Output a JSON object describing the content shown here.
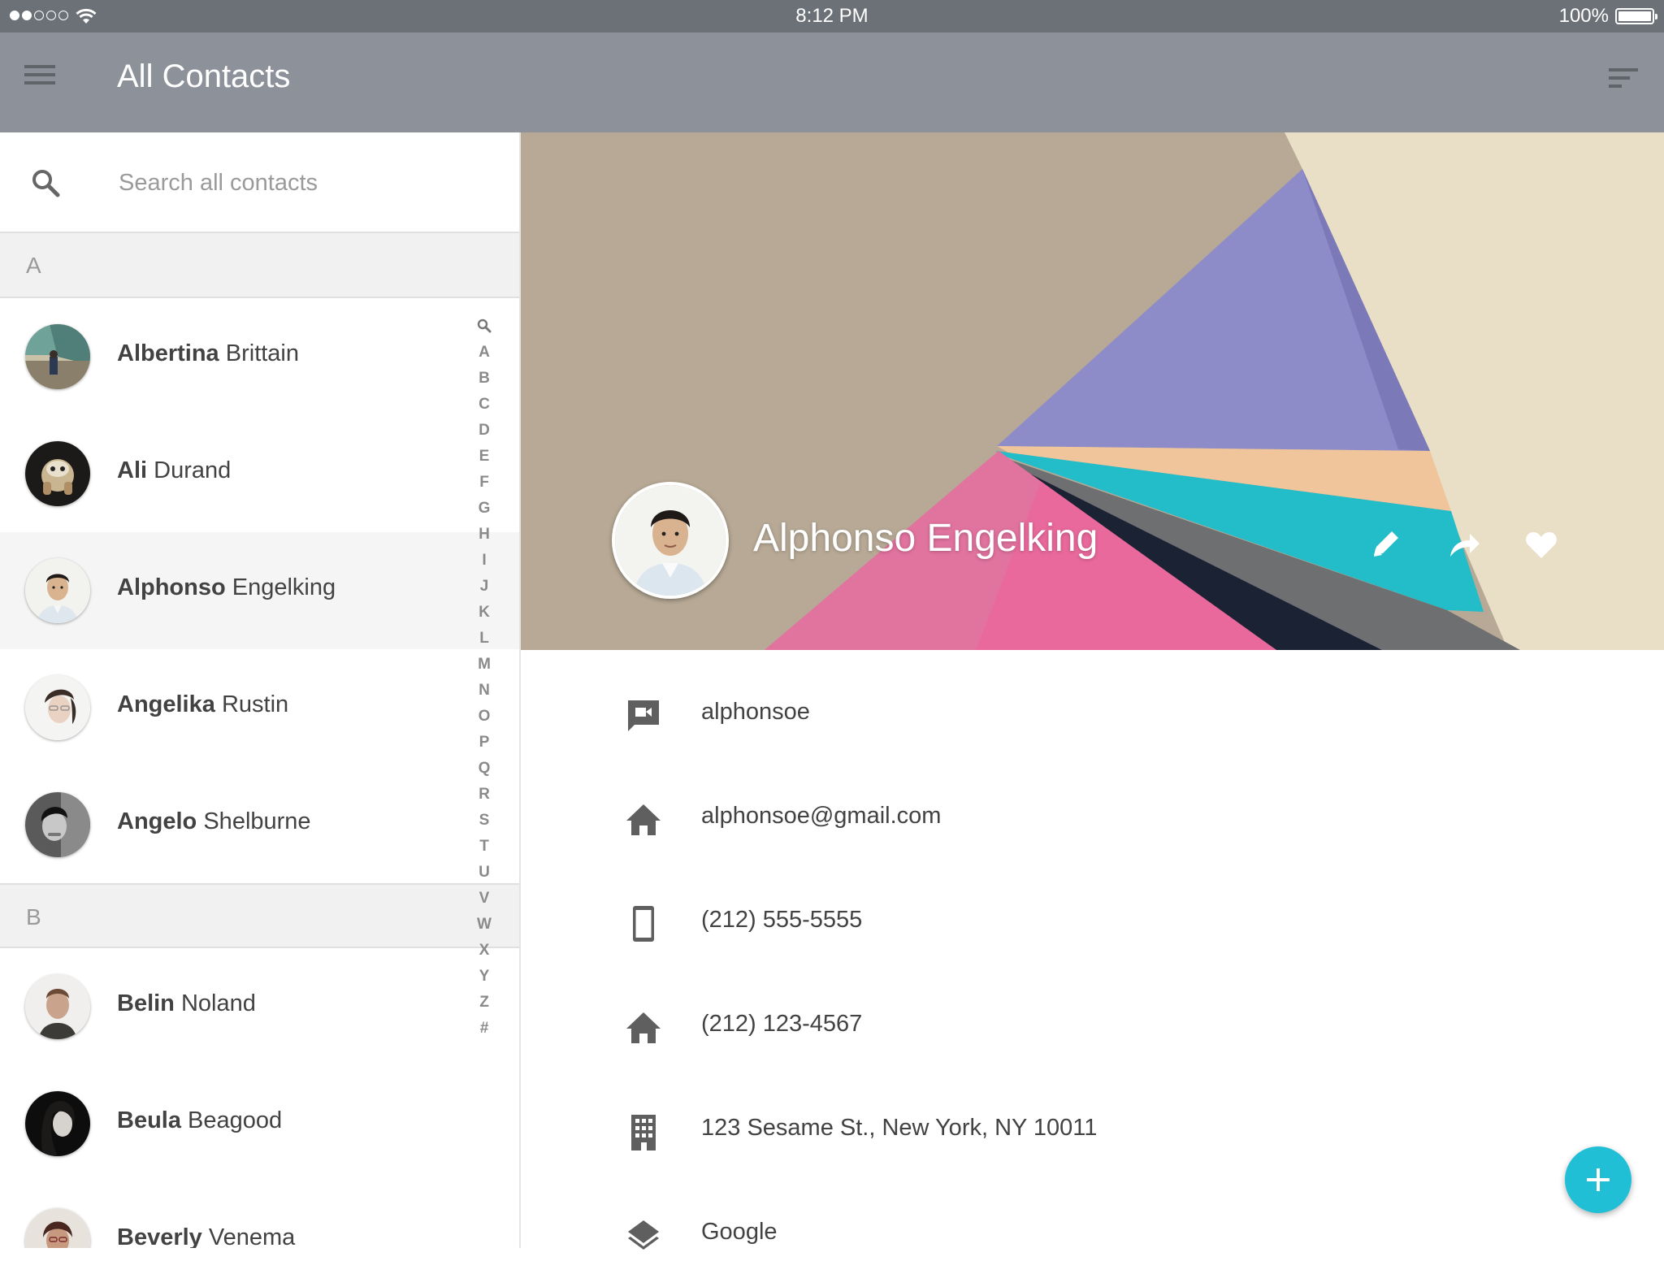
{
  "status_bar": {
    "time": "8:12 PM",
    "battery": "100%",
    "signal_dots_filled": 2,
    "signal_dots_total": 5
  },
  "app_bar": {
    "title": "All Contacts",
    "menu_icon": "hamburger-menu-icon",
    "sort_icon": "sort-icon"
  },
  "search": {
    "placeholder": "Search all contacts",
    "value": ""
  },
  "sections": [
    {
      "letter": "A",
      "contacts": [
        {
          "first": "Albertina",
          "last": "Brittain"
        },
        {
          "first": "Ali",
          "last": "Durand"
        },
        {
          "first": "Alphonso",
          "last": "Engelking",
          "selected": true
        },
        {
          "first": "Angelika",
          "last": "Rustin"
        },
        {
          "first": "Angelo",
          "last": "Shelburne"
        }
      ]
    },
    {
      "letter": "B",
      "contacts": [
        {
          "first": "Belin",
          "last": "Noland"
        },
        {
          "first": "Beula",
          "last": "Beagood"
        },
        {
          "first": "Beverly",
          "last": "Venema"
        }
      ]
    }
  ],
  "alpha_index": [
    "A",
    "B",
    "C",
    "D",
    "E",
    "F",
    "G",
    "H",
    "I",
    "J",
    "K",
    "L",
    "M",
    "N",
    "O",
    "P",
    "Q",
    "R",
    "S",
    "T",
    "U",
    "V",
    "W",
    "X",
    "Y",
    "Z",
    "#"
  ],
  "detail": {
    "name": "Alphonso Engelking",
    "actions": [
      "edit-icon",
      "share-icon",
      "favorite-icon"
    ],
    "fields": [
      {
        "icon": "video-chat-icon",
        "value": "alphonsoe"
      },
      {
        "icon": "home-icon",
        "value": "alphonsoe@gmail.com"
      },
      {
        "icon": "mobile-phone-icon",
        "value": "(212) 555-5555"
      },
      {
        "icon": "home-icon",
        "value": "(212) 123-4567"
      },
      {
        "icon": "building-icon",
        "value": "123 Sesame St., New York, NY 10011"
      },
      {
        "icon": "layers-icon",
        "value": "Google"
      }
    ]
  },
  "fab": {
    "icon": "add-icon"
  },
  "colors": {
    "status_bar": "#6c7077",
    "app_bar": "#8d9199",
    "accent": "#21bfd6",
    "section_header_bg": "#f1f1f1"
  }
}
